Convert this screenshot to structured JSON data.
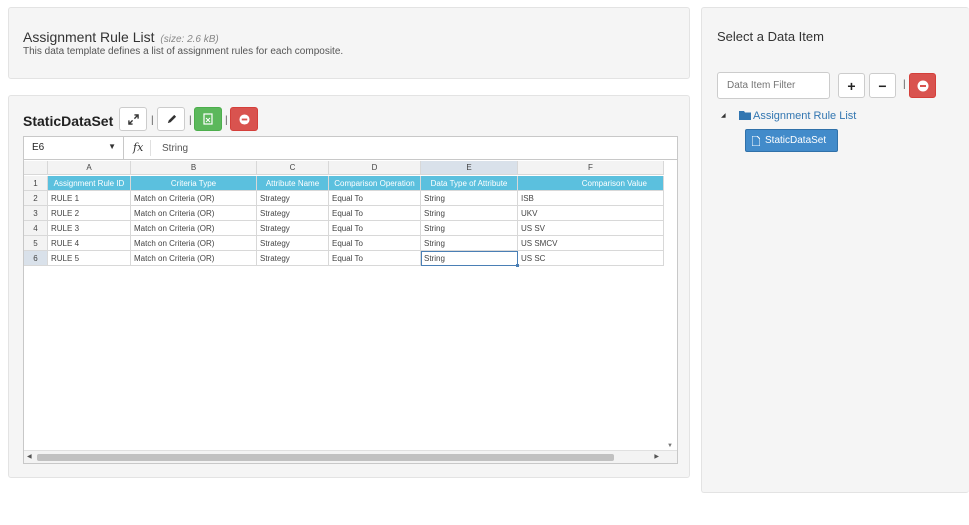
{
  "header": {
    "title": "Assignment Rule List",
    "size": "(size: 2.6 kB)",
    "description": "This data template defines a list of assignment rules for each composite."
  },
  "dataset": {
    "title": "StaticDataSet",
    "separator": "|",
    "buttons": [
      {
        "name": "expand-button",
        "icon": "expand-icon"
      },
      {
        "name": "edit-button",
        "icon": "pencil-icon"
      },
      {
        "name": "export-button",
        "icon": "spreadsheet-icon",
        "color": "#5cb85c"
      },
      {
        "name": "delete-button",
        "icon": "minus-circle-icon",
        "color": "#d9534f"
      }
    ]
  },
  "sheet": {
    "cell_ref": "E6",
    "fx_label": "fx",
    "formula_value": "String",
    "columns": [
      "A",
      "B",
      "C",
      "D",
      "E",
      "F"
    ],
    "rows": [
      "1",
      "2",
      "3",
      "4",
      "5",
      "6"
    ],
    "selected_column": "E",
    "selected_row": "6",
    "header_row": [
      "Assignment Rule ID",
      "Criteria Type",
      "Attribute Name",
      "Comparison Operation",
      "Data Type of Attribute",
      "Comparison Value"
    ],
    "data": [
      [
        "RULE 1",
        "Match on Criteria (OR)",
        "Strategy",
        "Equal To",
        "String",
        "ISB"
      ],
      [
        "RULE 2",
        "Match on Criteria (OR)",
        "Strategy",
        "Equal To",
        "String",
        "UKV"
      ],
      [
        "RULE 3",
        "Match on Criteria (OR)",
        "Strategy",
        "Equal To",
        "String",
        "US SV"
      ],
      [
        "RULE 4",
        "Match on Criteria (OR)",
        "Strategy",
        "Equal To",
        "String",
        "US SMCV"
      ],
      [
        "RULE 5",
        "Match on Criteria (OR)",
        "Strategy",
        "Equal To",
        "String",
        "US SC"
      ]
    ],
    "header_color": "#5bc0de"
  },
  "right_panel": {
    "title": "Select a Data Item",
    "filter_placeholder": "Data Item Filter",
    "add_label": "+",
    "remove_label": "−",
    "separator": "|",
    "tree": {
      "folder_label": "Assignment Rule List",
      "leaf_label": "StaticDataSet"
    },
    "accent": "#428bca"
  }
}
